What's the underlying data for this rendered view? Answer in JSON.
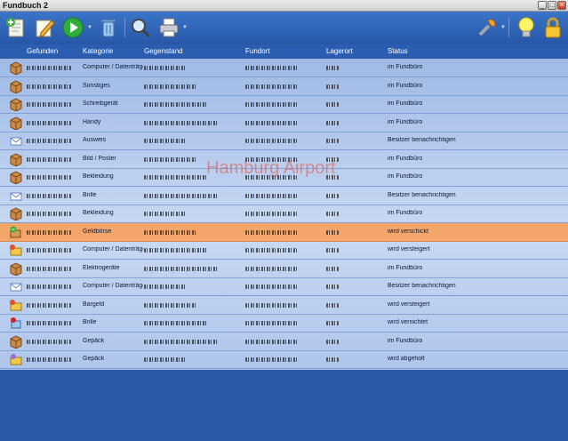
{
  "window": {
    "title": "Fundbuch 2"
  },
  "toolbar": {
    "icons": [
      "add-entry-icon",
      "edit-note-icon",
      "play-icon",
      "trash-icon",
      "search-icon",
      "print-icon",
      "tools-icon",
      "lightbulb-icon",
      "lock-icon"
    ]
  },
  "columns": [
    "Gefunden",
    "Kategorie",
    "Gegenstand",
    "Fundort",
    "Lagerort",
    "Status"
  ],
  "watermark": "Hamburg Airport",
  "rows": [
    {
      "icon": "box",
      "kategorie": "Computer / Datenträger",
      "status": "im Fundbüro"
    },
    {
      "icon": "box",
      "kategorie": "Sonstiges",
      "status": "im Fundbüro"
    },
    {
      "icon": "box",
      "kategorie": "Schreibgerät",
      "status": "im Fundbüro"
    },
    {
      "icon": "box",
      "kategorie": "Handy",
      "status": "im Fundbüro"
    },
    {
      "icon": "envelope",
      "kategorie": "Ausweis",
      "status": "Besitzer benachrichtigen"
    },
    {
      "icon": "box",
      "kategorie": "Bild / Poster",
      "status": "im Fundbüro"
    },
    {
      "icon": "box",
      "kategorie": "Bekleidung",
      "status": "im Fundbüro"
    },
    {
      "icon": "envelope",
      "kategorie": "Brille",
      "status": "Besitzer benachrichtigen"
    },
    {
      "icon": "box",
      "kategorie": "Bekleidung",
      "status": "im Fundbüro"
    },
    {
      "icon": "shipped",
      "kategorie": "Geldbörse",
      "status": "wird verschickt",
      "selected": true
    },
    {
      "icon": "auction",
      "kategorie": "Computer / Datenträger",
      "status": "wird versteigert"
    },
    {
      "icon": "box",
      "kategorie": "Elektrogeräte",
      "status": "im Fundbüro"
    },
    {
      "icon": "envelope",
      "kategorie": "Computer / Datenträger",
      "status": "Besitzer benachrichtigen"
    },
    {
      "icon": "auction",
      "kategorie": "Bargeld",
      "status": "wird versteigert"
    },
    {
      "icon": "destroy",
      "kategorie": "Brille",
      "status": "wird vernichtet"
    },
    {
      "icon": "box",
      "kategorie": "Gepäck",
      "status": "im Fundbüro"
    },
    {
      "icon": "collected",
      "kategorie": "Gepäck",
      "status": "wird abgeholt"
    }
  ],
  "colors": {
    "accent": "#2a5aa8",
    "selected": "#f4a66a",
    "rows": "#b7cdef"
  }
}
